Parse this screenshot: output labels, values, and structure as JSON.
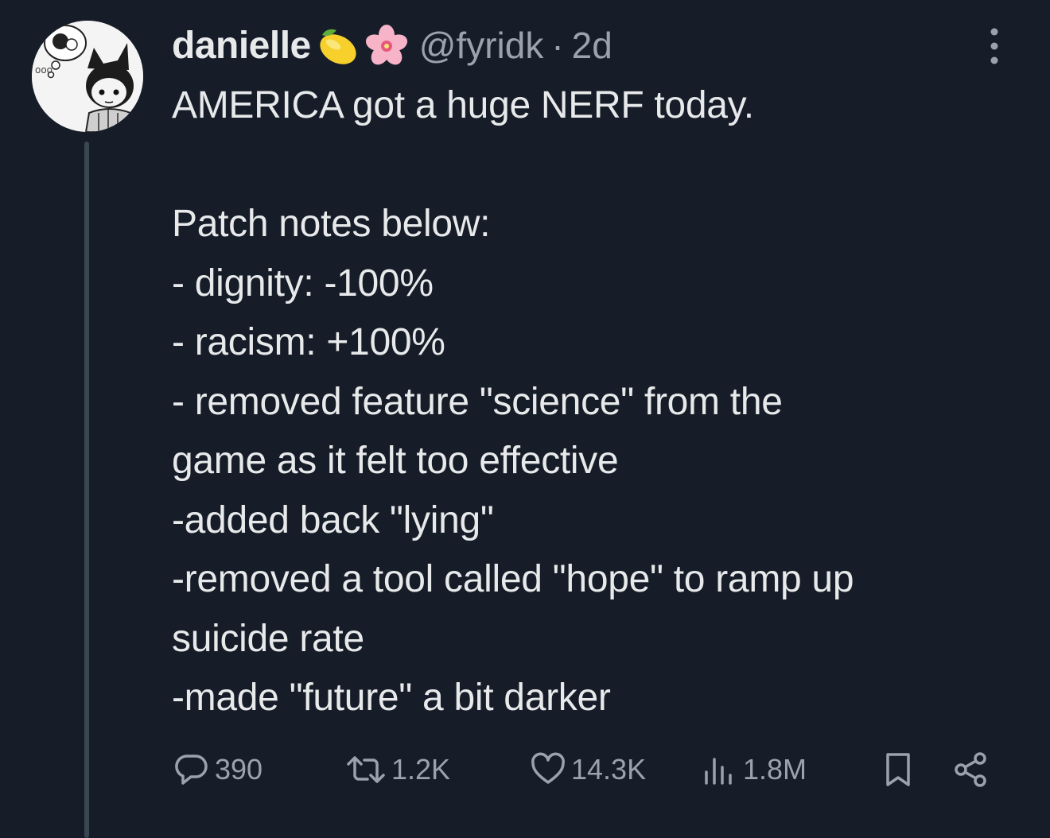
{
  "user": {
    "display_name": "danielle",
    "handle": "@fyridk",
    "separator": "·",
    "time": "2d",
    "badges": [
      "lemon-emoji",
      "cherry-blossom-emoji"
    ]
  },
  "tweet": {
    "lines": [
      "AMERICA got a huge NERF today.",
      "",
      "Patch notes below:",
      "- dignity: -100%",
      "- racism: +100%",
      "- removed feature \"science\" from the",
      "game as it felt too effective",
      "-added back \"lying\"",
      "-removed a tool called \"hope\" to ramp up",
      "suicide rate",
      "-made \"future\" a bit darker"
    ]
  },
  "actions": {
    "replies": "390",
    "reposts": "1.2K",
    "likes": "14.3K",
    "views": "1.8M",
    "icons": [
      "reply-icon",
      "repost-icon",
      "like-icon",
      "views-icon",
      "bookmark-icon",
      "share-icon",
      "more-icon"
    ]
  },
  "colors": {
    "background": "#161d28",
    "text": "#e7e9ea",
    "muted": "#9aa3ad",
    "thread_line": "#3b4653"
  }
}
